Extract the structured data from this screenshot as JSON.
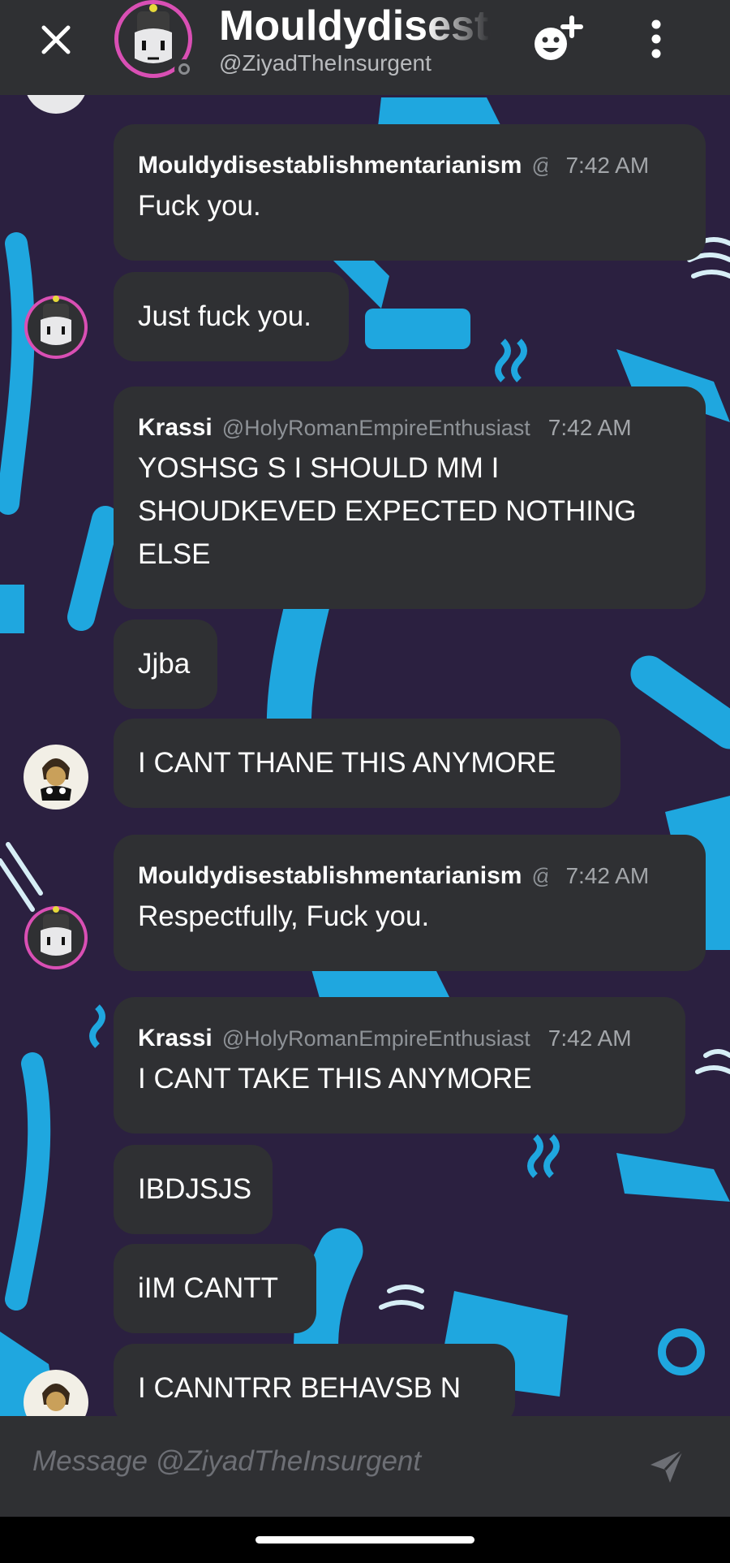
{
  "header": {
    "title": "Mouldydisestablishmentarianism",
    "handle": "@ZiyadTheInsurgent"
  },
  "messages": [
    {
      "author": "Mouldydisestablishmentarianism",
      "handle": "@ZiyadTheInsurgent",
      "time": "7:42 AM",
      "text": "Fuck you."
    },
    {
      "text": "Just fuck you."
    },
    {
      "author": "Krassi",
      "handle": "@HolyRomanEmpireEnthusiast",
      "time": "7:42 AM",
      "text": "YOSHSG S I SHOULD MM I SHOUDKEVED EXPECTED NOTHING ELSE"
    },
    {
      "text": "Jjba"
    },
    {
      "text": "I CANT THANE THIS ANYMORE"
    },
    {
      "author": "Mouldydisestablishmentarianism",
      "handle": "@ZiyadTheInsurgent",
      "time": "7:42 AM",
      "text": "Respectfully, Fuck you."
    },
    {
      "author": "Krassi",
      "handle": "@HolyRomanEmpireEnthusiast",
      "time": "7:42 AM",
      "text": "I CANT TAKE THIS ANYMORE"
    },
    {
      "text": "IBDJSJS"
    },
    {
      "text": "iIM CANTT"
    },
    {
      "text": "I CANNTRR BEHAVSB N"
    }
  ],
  "composer": {
    "placeholder": "Message @ZiyadTheInsurgent"
  },
  "colors": {
    "bubble": "#2f3033",
    "background": "#2b2040",
    "accent_pattern": "#1fa7df",
    "avatar_ring": "#e060c0"
  }
}
